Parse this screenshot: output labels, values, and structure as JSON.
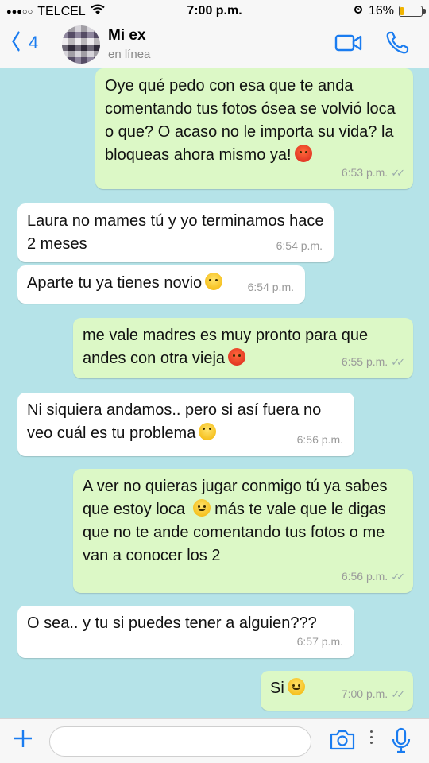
{
  "status_bar": {
    "signal_dots": "●●●○○",
    "carrier": "TELCEL",
    "time": "7:00 p.m.",
    "battery": "16%",
    "battery_level": 0.16
  },
  "header": {
    "back_count": "4",
    "contact_name": "Mi ex",
    "contact_status": "en línea"
  },
  "messages": [
    {
      "dir": "out",
      "text": "Oye qué pedo con esa que te anda comentando tus fotos ósea se volvió loca o que? O acaso no le importa su vida? la bloqueas ahora mismo ya!",
      "time": "6:53 p.m."
    },
    {
      "dir": "in",
      "text": "Laura no mames tú y yo terminamos hace 2 meses",
      "time": "6:54 p.m."
    },
    {
      "dir": "in",
      "text": "Aparte tu ya tienes novio",
      "time": "6:54 p.m."
    },
    {
      "dir": "out",
      "text": "me vale madres es muy pronto para que andes con otra vieja",
      "time": "6:55 p.m."
    },
    {
      "dir": "in",
      "text": "Ni siquiera andamos.. pero si así fuera no veo cuál es tu problema",
      "time": "6:56 p.m."
    },
    {
      "dir": "out",
      "text": "A ver no quieras jugar conmigo tú ya sabes que estoy loca",
      "text2": "más te vale que le digas que no te ande comentando tus fotos o me van a conocer los 2",
      "time": "6:56 p.m."
    },
    {
      "dir": "in",
      "text": "O sea.. y tu si puedes tener a alguien???",
      "time": "6:57 p.m."
    },
    {
      "dir": "out",
      "text": "Si",
      "time": "7:00 p.m."
    }
  ],
  "input": {
    "placeholder": ""
  },
  "colors": {
    "accent": "#1a7cf0",
    "outgoing": "#dcf8c6",
    "incoming": "#ffffff",
    "background": "#b5e3e8"
  }
}
